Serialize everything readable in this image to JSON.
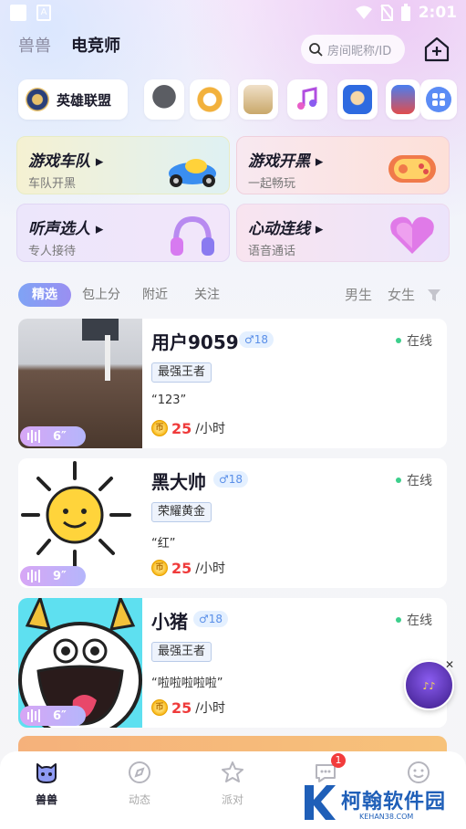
{
  "status_bar": {
    "time": "2:01"
  },
  "header": {
    "tabs": [
      {
        "label": "兽兽"
      },
      {
        "label": "电竞师"
      }
    ],
    "search_placeholder": "房间昵称/ID"
  },
  "games": {
    "main_label": "英雄联盟"
  },
  "features": [
    {
      "title": "游戏车队",
      "subtitle": "车队开黑"
    },
    {
      "title": "游戏开黑",
      "subtitle": "一起畅玩"
    },
    {
      "title": "听声选人",
      "subtitle": "专人接待"
    },
    {
      "title": "心动连线",
      "subtitle": "语音通话"
    }
  ],
  "filters": {
    "tabs": [
      "精选",
      "包上分",
      "附近",
      "关注"
    ],
    "genders": [
      "男生",
      "女生"
    ]
  },
  "users": [
    {
      "name": "用户9059",
      "gender": "♂",
      "age": "18",
      "status": "在线",
      "rank": "最强王者",
      "quote": "“123”",
      "price": "25",
      "unit": "/小时",
      "voice_len": "6″"
    },
    {
      "name": "黑大帅",
      "gender": "♂",
      "age": "18",
      "status": "在线",
      "rank": "荣耀黄金",
      "quote": "“红”",
      "price": "25",
      "unit": "/小时",
      "voice_len": "9″"
    },
    {
      "name": "小猪",
      "gender": "♂",
      "age": "18",
      "status": "在线",
      "rank": "最强王者",
      "quote": "“啦啦啦啦啦”",
      "price": "25",
      "unit": "/小时",
      "voice_len": "6″"
    }
  ],
  "bottom_nav": {
    "items": [
      {
        "label": "兽兽"
      },
      {
        "label": "动态"
      },
      {
        "label": "派对"
      },
      {
        "label": ""
      },
      {
        "label": ""
      }
    ],
    "message_badge": "1"
  },
  "watermark": {
    "name": "柯翰软件园",
    "domain": "KEHAN38.COM"
  },
  "colors": {
    "accent": "#8f9bf4",
    "price": "#ef3b3b",
    "online": "#3ccf8c"
  }
}
